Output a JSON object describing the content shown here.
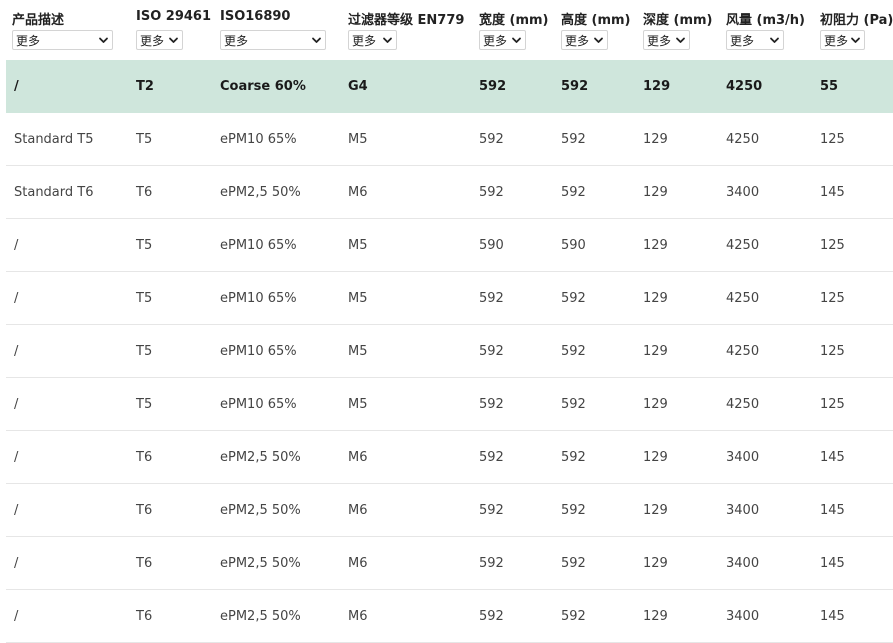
{
  "columns": [
    {
      "label": "产品描述",
      "filter": "更多"
    },
    {
      "label": "ISO 29461",
      "filter": "更多"
    },
    {
      "label": "ISO16890",
      "filter": "更多"
    },
    {
      "label": "过滤器等级 EN779",
      "filter": "更多"
    },
    {
      "label": "宽度 (mm)",
      "filter": "更多"
    },
    {
      "label": "高度 (mm)",
      "filter": "更多"
    },
    {
      "label": "深度 (mm)",
      "filter": "更多"
    },
    {
      "label": "风量 (m3/h)",
      "filter": "更多"
    },
    {
      "label": "初阻力 (Pa)",
      "filter": "更多"
    }
  ],
  "rows": [
    {
      "highlighted": true,
      "cells": [
        "/",
        "T2",
        "Coarse 60%",
        "G4",
        "592",
        "592",
        "129",
        "4250",
        "55"
      ]
    },
    {
      "cells": [
        "Standard T5",
        "T5",
        "ePM10 65%",
        "M5",
        "592",
        "592",
        "129",
        "4250",
        "125"
      ]
    },
    {
      "cells": [
        "Standard T6",
        "T6",
        "ePM2,5 50%",
        "M6",
        "592",
        "592",
        "129",
        "3400",
        "145"
      ]
    },
    {
      "cells": [
        "/",
        "T5",
        "ePM10 65%",
        "M5",
        "590",
        "590",
        "129",
        "4250",
        "125"
      ]
    },
    {
      "cells": [
        "/",
        "T5",
        "ePM10 65%",
        "M5",
        "592",
        "592",
        "129",
        "4250",
        "125"
      ]
    },
    {
      "cells": [
        "/",
        "T5",
        "ePM10 65%",
        "M5",
        "592",
        "592",
        "129",
        "4250",
        "125"
      ]
    },
    {
      "cells": [
        "/",
        "T5",
        "ePM10 65%",
        "M5",
        "592",
        "592",
        "129",
        "4250",
        "125"
      ]
    },
    {
      "cells": [
        "/",
        "T6",
        "ePM2,5 50%",
        "M6",
        "592",
        "592",
        "129",
        "3400",
        "145"
      ]
    },
    {
      "cells": [
        "/",
        "T6",
        "ePM2,5 50%",
        "M6",
        "592",
        "592",
        "129",
        "3400",
        "145"
      ]
    },
    {
      "cells": [
        "/",
        "T6",
        "ePM2,5 50%",
        "M6",
        "592",
        "592",
        "129",
        "3400",
        "145"
      ]
    },
    {
      "cells": [
        "/",
        "T6",
        "ePM2,5 50%",
        "M6",
        "592",
        "592",
        "129",
        "3400",
        "145"
      ]
    }
  ],
  "colors": {
    "highlight_row": "#cfe6dc",
    "row_divider": "#e6e6e6"
  },
  "icons": {
    "filter_dropdown": "chevron-down-icon"
  }
}
